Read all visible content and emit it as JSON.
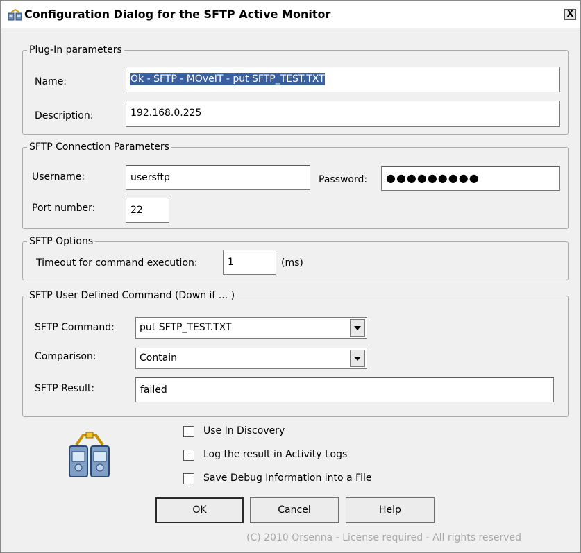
{
  "window": {
    "title": "Configuration Dialog for the SFTP Active Monitor",
    "close_label": "X"
  },
  "plugin_params": {
    "legend": "Plug-In parameters",
    "name_label": "Name:",
    "name_value": "Ok - SFTP - MOveIT - put SFTP_TEST.TXT",
    "description_label": "Description:",
    "description_value": "192.168.0.225"
  },
  "connection": {
    "legend": "SFTP Connection Parameters",
    "username_label": "Username:",
    "username_value": "usersftp",
    "password_label": "Password:",
    "password_value": "●●●●●●●●●",
    "port_label": "Port number:",
    "port_value": "22"
  },
  "options": {
    "legend": "SFTP Options",
    "timeout_label": "Timeout for command execution:",
    "timeout_value": "1",
    "timeout_unit": "(ms)"
  },
  "user_command": {
    "legend": "SFTP User Defined Command (Down if ... )",
    "command_label": "SFTP Command:",
    "command_value": "put SFTP_TEST.TXT",
    "comparison_label": "Comparison:",
    "comparison_value": "Contain",
    "result_label": "SFTP Result:",
    "result_value": "failed"
  },
  "checkboxes": [
    {
      "label": "Use In Discovery",
      "checked": false
    },
    {
      "label": "Log the result in Activity Logs",
      "checked": false
    },
    {
      "label": "Save Debug Information into a File",
      "checked": false
    }
  ],
  "buttons": {
    "ok": "OK",
    "cancel": "Cancel",
    "help": "Help"
  },
  "footer": "(C) 2010 Orsenna - License required - All rights reserved",
  "icons": {
    "title": "network-monitor-icon",
    "plugin": "plugin-computers-icon"
  }
}
